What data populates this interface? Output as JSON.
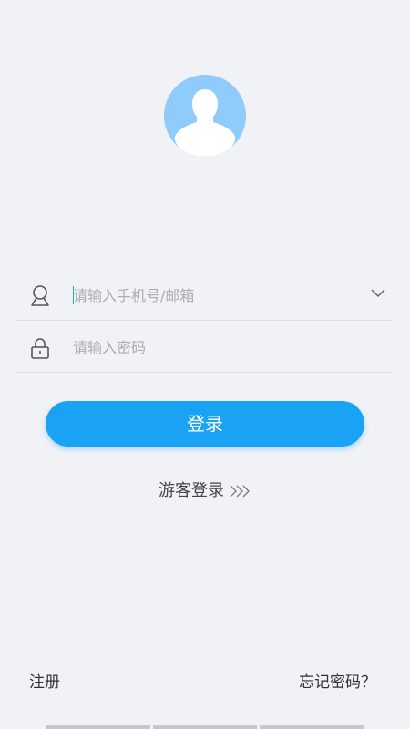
{
  "login": {
    "account_placeholder": "请输入手机号/邮箱",
    "password_placeholder": "请输入密码",
    "login_button": "登录",
    "guest_login": "游客登录",
    "register": "注册",
    "forgot_password": "忘记密码？"
  },
  "icons": {
    "avatar": "avatar-icon",
    "user": "user-icon",
    "lock": "lock-icon",
    "dropdown": "chevron-down-icon",
    "guest_arrow": "double-chevron-right-icon"
  },
  "colors": {
    "primary": "#1aa3f5",
    "avatar_bg": "#8fcbfb",
    "background": "#f1f2f5"
  }
}
